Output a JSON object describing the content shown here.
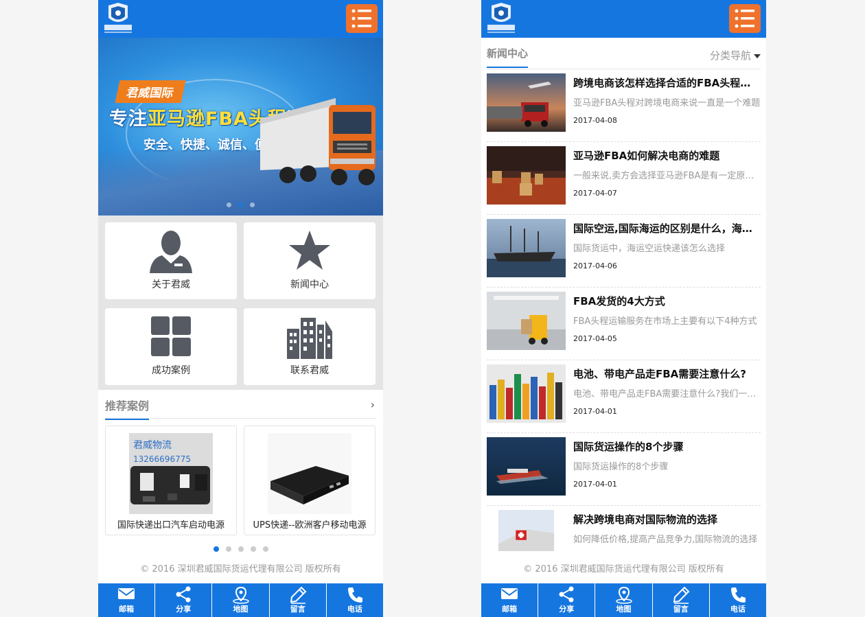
{
  "left": {
    "banner": {
      "tag": "君威国际",
      "title_prefix": "专注",
      "title_highlight": "亚马逊FBA头程",
      "title_suffix": "运输",
      "slogan": "安全、快捷、诚信、便利"
    },
    "tiles": [
      {
        "label": "关于君威",
        "icon": "person-icon"
      },
      {
        "label": "新闻中心",
        "icon": "star-icon"
      },
      {
        "label": "成功案例",
        "icon": "grid-icon"
      },
      {
        "label": "联系君威",
        "icon": "buildings-icon"
      }
    ],
    "cases_section": {
      "title": "推荐案例",
      "items": [
        {
          "caption": "国际快递出口汽车启动电源",
          "img_text": "君威物流",
          "img_phone": "13266696775"
        },
        {
          "caption": "UPS快递--欧洲客户移动电源"
        }
      ]
    }
  },
  "right": {
    "news_title": "新闻中心",
    "category_nav": "分类导航",
    "news": [
      {
        "title": "跨境电商该怎样选择合适的FBA头程运输",
        "desc": "亚马逊FBA头程对跨境电商来说一直是一个难题",
        "date": "2017-04-08"
      },
      {
        "title": "亚马逊FBA如何解决电商的难题",
        "desc": "一般来说,卖方会选择亚马逊FBA是有一定原因的",
        "date": "2017-04-07"
      },
      {
        "title": "国际空运,国际海运的区别是什么，海运空运",
        "desc": "国际货运中，海运空运快递该怎么选择",
        "date": "2017-04-06"
      },
      {
        "title": "FBA发货的4大方式",
        "desc": "FBA头程运输服务在市场上主要有以下4种方式",
        "date": "2017-04-05"
      },
      {
        "title": "电池、带电产品走FBA需要注意什么?",
        "desc": "电池、带电产品走FBA需要注意什么?我们一起来看看",
        "date": "2017-04-01"
      },
      {
        "title": "国际货运操作的8个步骤",
        "desc": "国际货运操作的8个步骤",
        "date": "2017-04-01"
      },
      {
        "title": "解决跨境电商对国际物流的选择",
        "desc": "如何降低价格,提高产品竞争力,国际物流的选择",
        "date": ""
      }
    ]
  },
  "copyright": "© 2016 深圳君威国际货运代理有限公司 版权所有",
  "footer": [
    "邮箱",
    "分享",
    "地图",
    "留言",
    "电话"
  ],
  "colors": {
    "primary": "#1676e0",
    "menu_button": "#f0712c",
    "banner_tag": "#f07d1c"
  }
}
